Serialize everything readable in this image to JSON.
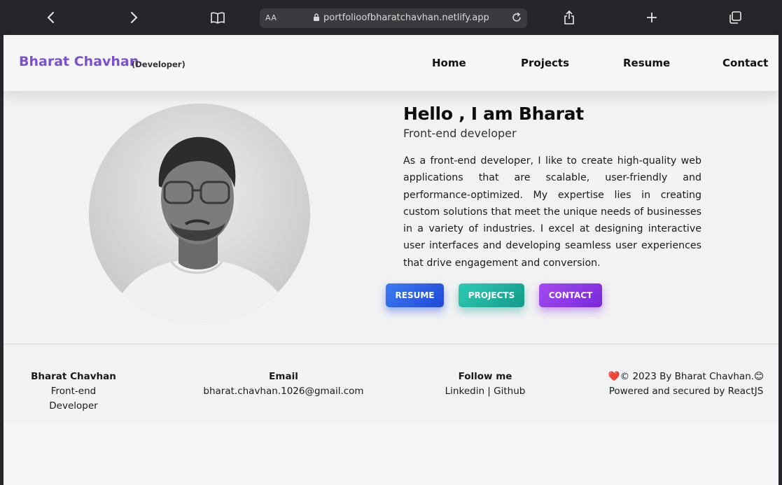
{
  "browser": {
    "url": "portfolioofbharatchavhan.netlify.app",
    "reader_label": "AA",
    "icons": [
      "back-icon",
      "forward-icon",
      "book-icon",
      "lock-icon",
      "reload-icon",
      "share-icon",
      "plus-icon",
      "tabs-icon"
    ]
  },
  "nav": {
    "brand": "Bharat Chavhan",
    "brand_sub": "(Developer)",
    "links": [
      "Home",
      "Projects",
      "Resume",
      "Contact"
    ]
  },
  "hero": {
    "greeting": "Hello , I am Bharat",
    "role": "Front-end developer",
    "bio": "As a front-end developer, I like to create high-quality web applications that are scalable, user-friendly and performance-optimized. My expertise lies in creating custom solutions that meet the unique needs of businesses in a variety of industries. I excel at designing interactive user interfaces and developing seamless user experiences that drive engagement and conversion.",
    "buttons": [
      "RESUME",
      "PROJECTS",
      "CONTACT"
    ]
  },
  "footer": {
    "name": "Bharat Chavhan",
    "title": "Front-end Developer",
    "email_label": "Email",
    "email": "bharat.chavhan.1026@gmail.com",
    "follow_label": "Follow me",
    "follow_links": "Linkedin | Github",
    "copyright": "❤️© 2023 By Bharat Chavhan.😊",
    "powered": "Powered and secured by ReactJS"
  },
  "colors": {
    "brand": "#7a4fd0",
    "resume_button": "#2d62e6",
    "projects_button": "#1fb3a0",
    "contact_button": "#8e3ae6",
    "chrome": "#252629"
  }
}
